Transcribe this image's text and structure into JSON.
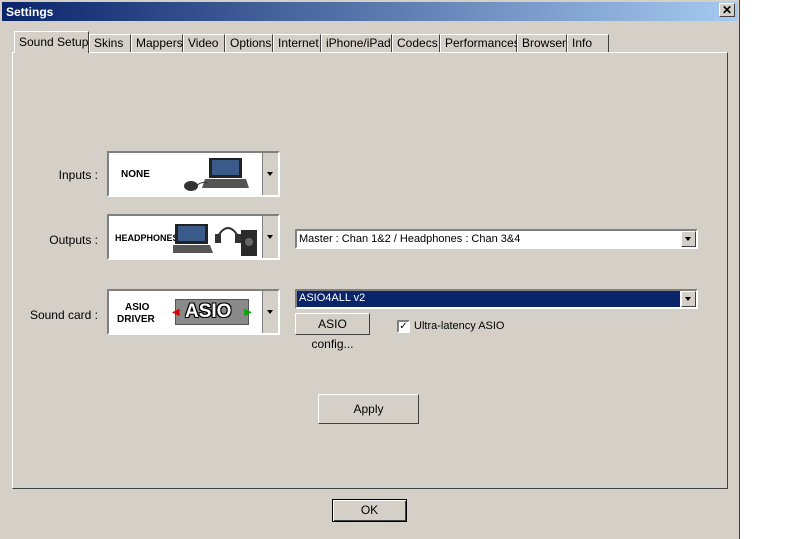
{
  "window": {
    "title": "Settings"
  },
  "tabs": [
    "Sound Setup",
    "Skins",
    "Mappers",
    "Video",
    "Options",
    "Internet",
    "iPhone/iPad",
    "Codecs",
    "Performances",
    "Browser",
    "Info"
  ],
  "inputs": {
    "label": "Inputs :",
    "device": "NONE"
  },
  "outputs": {
    "label": "Outputs :",
    "device": "HEADPHONES",
    "routing": "Master : Chan 1&2 / Headphones : Chan 3&4"
  },
  "soundcard": {
    "label": "Sound card :",
    "device_line1": "ASIO",
    "device_line2": "DRIVER",
    "logo_text": "ASIO",
    "driver": "ASIO4ALL v2",
    "config_button": "ASIO config...",
    "ultra_latency_label": "Ultra-latency ASIO",
    "ultra_latency_checked": true
  },
  "buttons": {
    "apply": "Apply",
    "ok": "OK"
  }
}
